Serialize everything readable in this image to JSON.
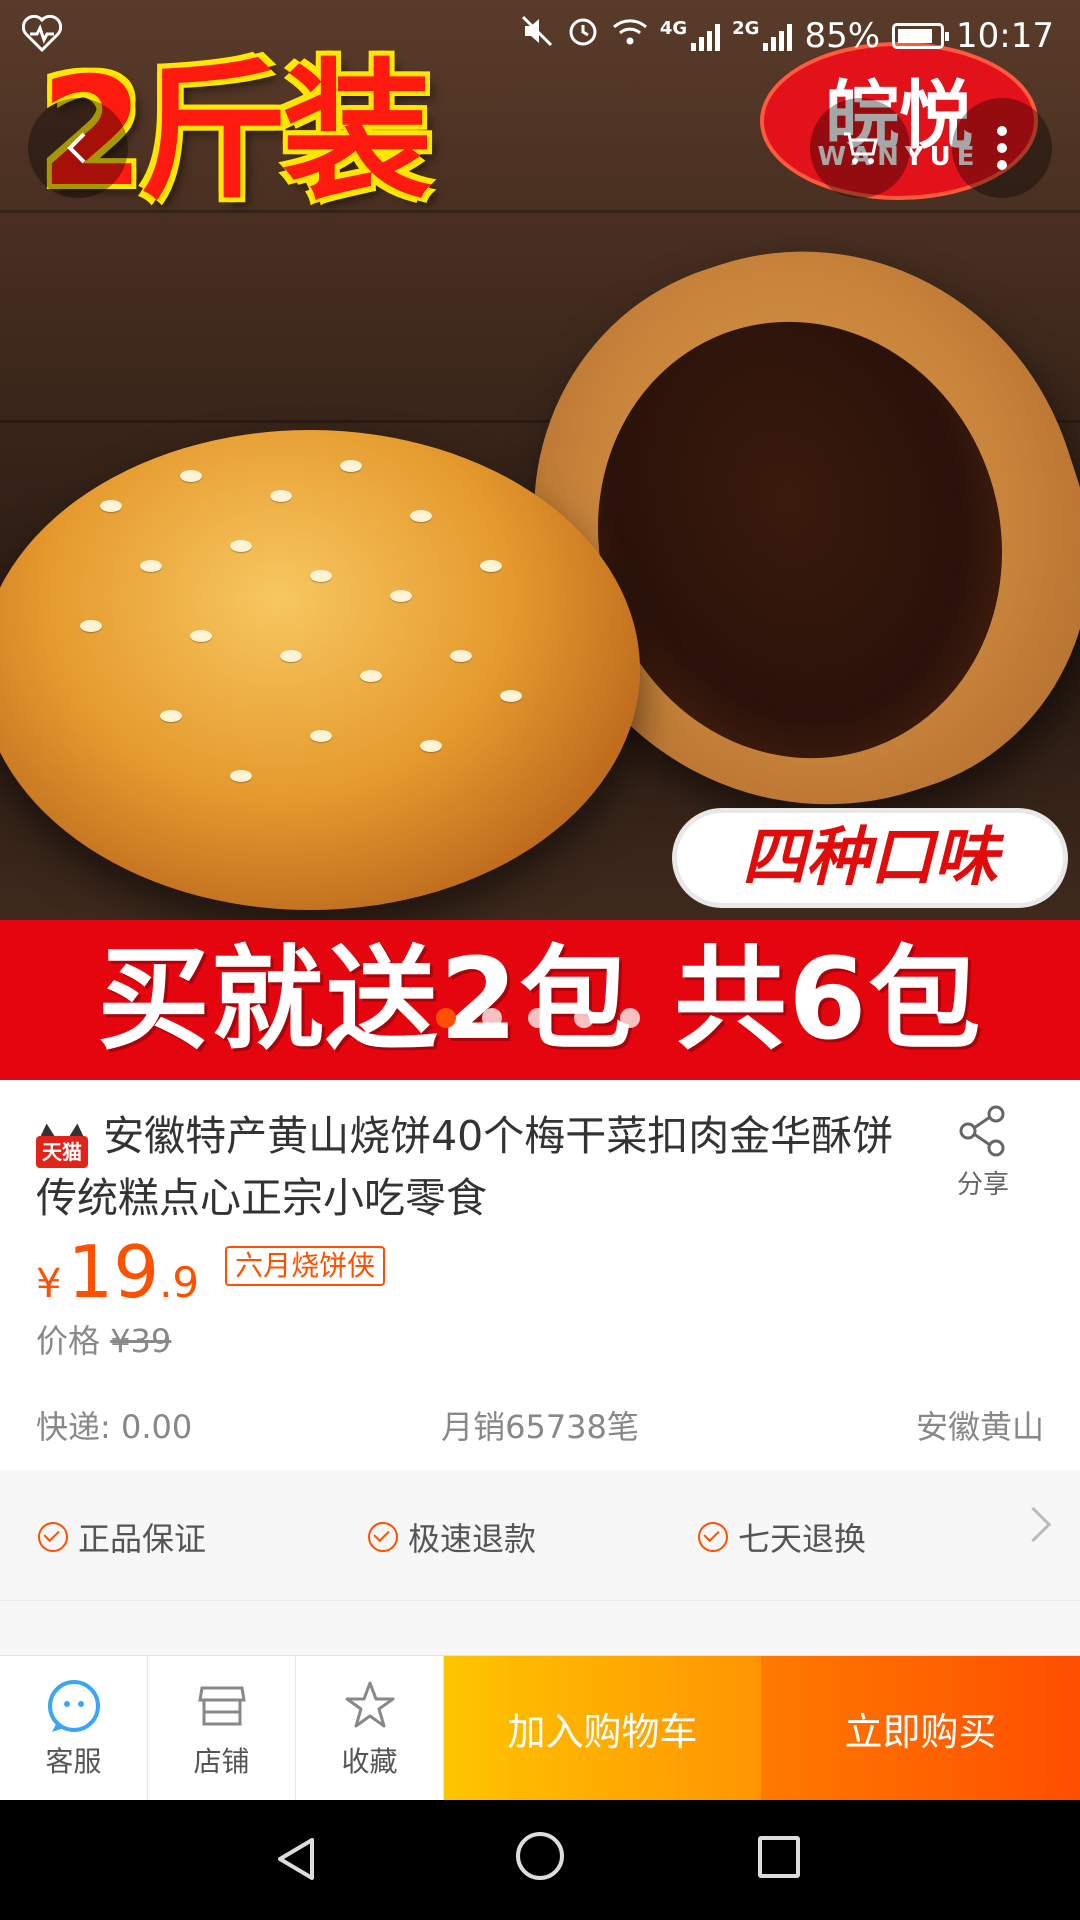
{
  "status_bar": {
    "network_1": "4G",
    "network_2": "2G",
    "battery": "85%",
    "battery_level": 0.85,
    "time": "10:17"
  },
  "hero": {
    "badge_text": "2斤装",
    "brand_cn": "皖悦",
    "brand_en": "WANYUE",
    "flavor_text": "四种口味",
    "promo_text": "买就送2包 共6包",
    "carousel_count": 5,
    "carousel_active_index": 0
  },
  "product": {
    "store_badge": "天猫",
    "title": "安徽特产黄山烧饼40个梅干菜扣肉金华酥饼传统糕点心正宗小吃零食",
    "share_label": "分享",
    "currency": "¥",
    "price_int": "19",
    "price_dec": ".9",
    "promo_tag": "六月烧饼侠",
    "orig_label": "价格",
    "orig_price": "¥39",
    "shipping": "快递: 0.00",
    "monthly_sales": "月销65738笔",
    "location": "安徽黄山"
  },
  "guarantees": [
    "正品保证",
    "极速退款",
    "七天退换"
  ],
  "action_bar": {
    "service": "客服",
    "store": "店铺",
    "favorite": "收藏",
    "add_to_cart": "加入购物车",
    "buy_now": "立即购买"
  },
  "colors": {
    "accent": "#ff5000",
    "cart_gradient": [
      "#ffc500",
      "#ff9402"
    ],
    "buy_gradient": [
      "#ff7a00",
      "#ff4e00"
    ],
    "promo_red": "#e5050e"
  }
}
